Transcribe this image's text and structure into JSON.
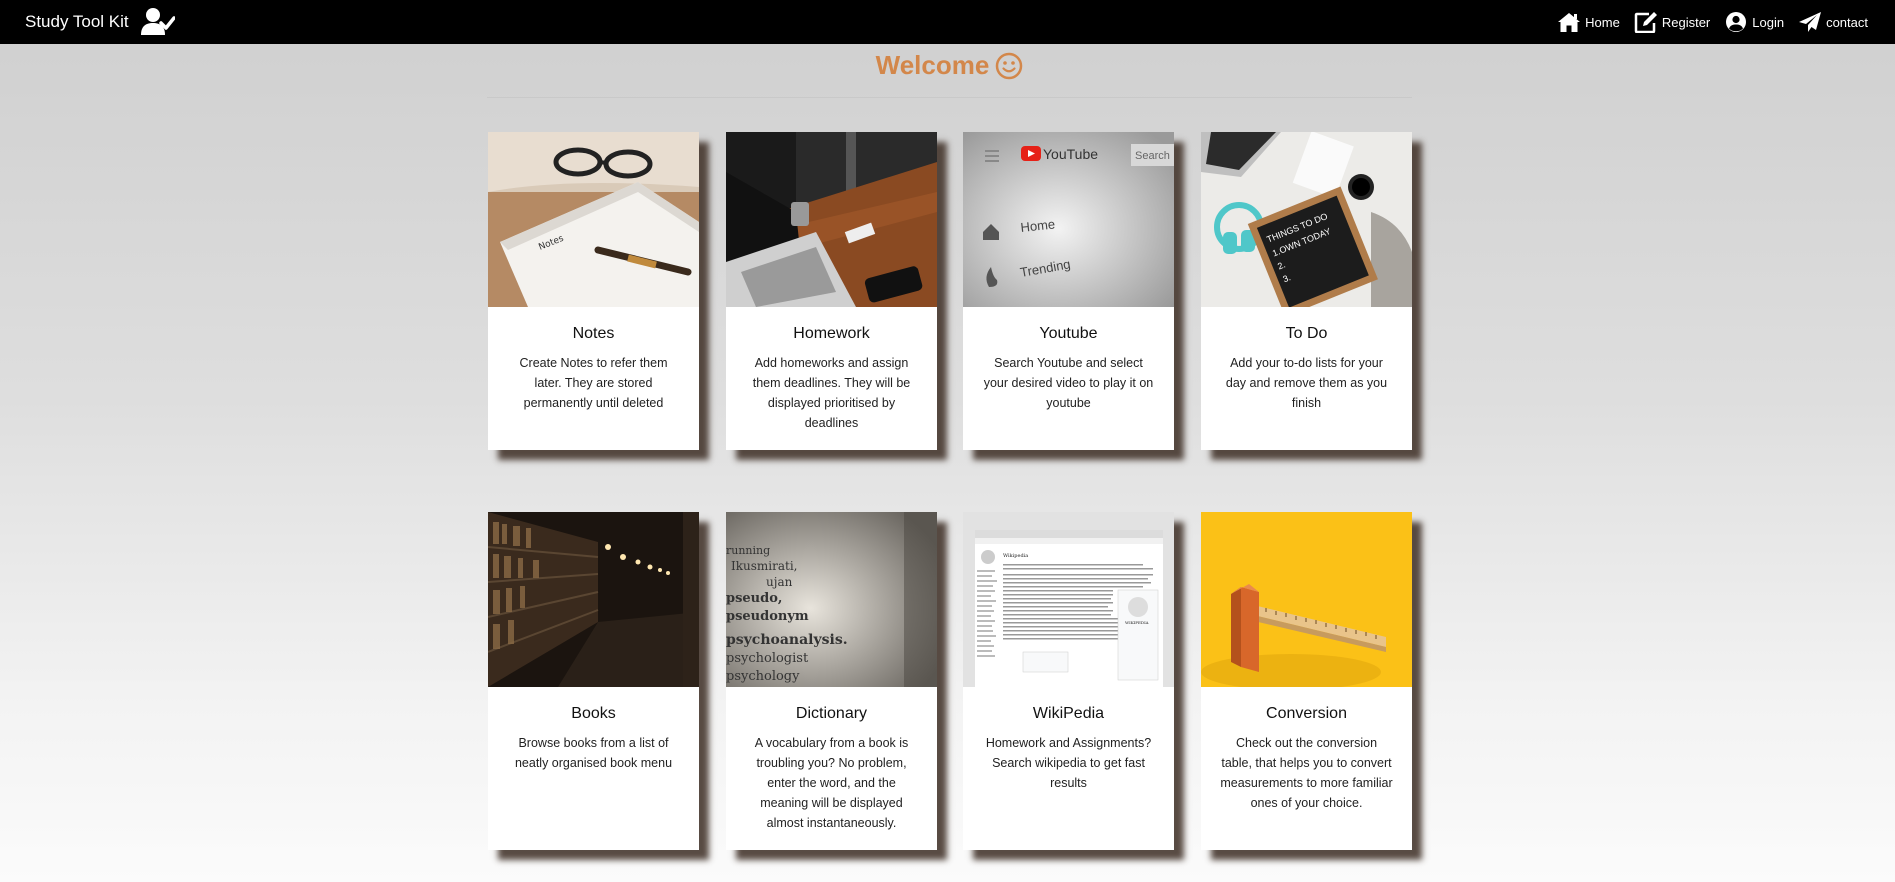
{
  "navbar": {
    "brand": "Study Tool Kit",
    "brand_icon": "user-check-icon",
    "links": [
      {
        "label": "Home",
        "icon": "home-icon"
      },
      {
        "label": "Register",
        "icon": "edit-icon"
      },
      {
        "label": "Login",
        "icon": "user-circle-icon"
      },
      {
        "label": "contact",
        "icon": "paper-plane-icon"
      }
    ]
  },
  "welcome": {
    "title": "Welcome",
    "icon": "smile-icon",
    "color": "#d3874a"
  },
  "cards": [
    {
      "title": "Notes",
      "description": "Create Notes to refer them later. They are stored permanently until deleted",
      "image": "notebook-pen-photo"
    },
    {
      "title": "Homework",
      "description": "Add homeworks and assign them deadlines. They will be displayed prioritised by deadlines",
      "image": "laptop-desk-photo"
    },
    {
      "title": "Youtube",
      "description": "Search Youtube and select your desired video to play it on youtube",
      "image": "youtube-screen-photo"
    },
    {
      "title": "To Do",
      "description": "Add your to-do lists for your day and remove them as you finish",
      "image": "todo-board-photo"
    },
    {
      "title": "Books",
      "description": "Browse books from a list of neatly organised book menu",
      "image": "library-shelves-photo"
    },
    {
      "title": "Dictionary",
      "description": "A vocabulary from a book is troubling you? No problem, enter the word, and the meaning will be displayed almost instantaneously.",
      "image": "dictionary-page-photo"
    },
    {
      "title": "WikiPedia",
      "description": "Homework and Assignments? Search wikipedia to get fast results",
      "image": "wikipedia-screenshot"
    },
    {
      "title": "Conversion",
      "description": "Check out the conversion table, that helps you to convert measurements to more familiar ones of your choice.",
      "image": "ruler-yellow-photo"
    }
  ],
  "thumb_text": {
    "notes_paper": "Notes",
    "youtube_logo": "YouTube",
    "youtube_search": "Search",
    "youtube_home": "Home",
    "youtube_trending": "Trending",
    "todo_board": [
      "THINGS TO DO",
      "1.OWN TODAY",
      "2.",
      "3."
    ],
    "dictionary_words": [
      "running",
      "Ikusmirati,",
      "ujan",
      "pseudo,",
      "pseudonym",
      "psychoanalysis.",
      "psychologist",
      "psychology"
    ],
    "wiki_title": "Wikipedia",
    "wiki_logo": "WIKIPEDIA"
  }
}
